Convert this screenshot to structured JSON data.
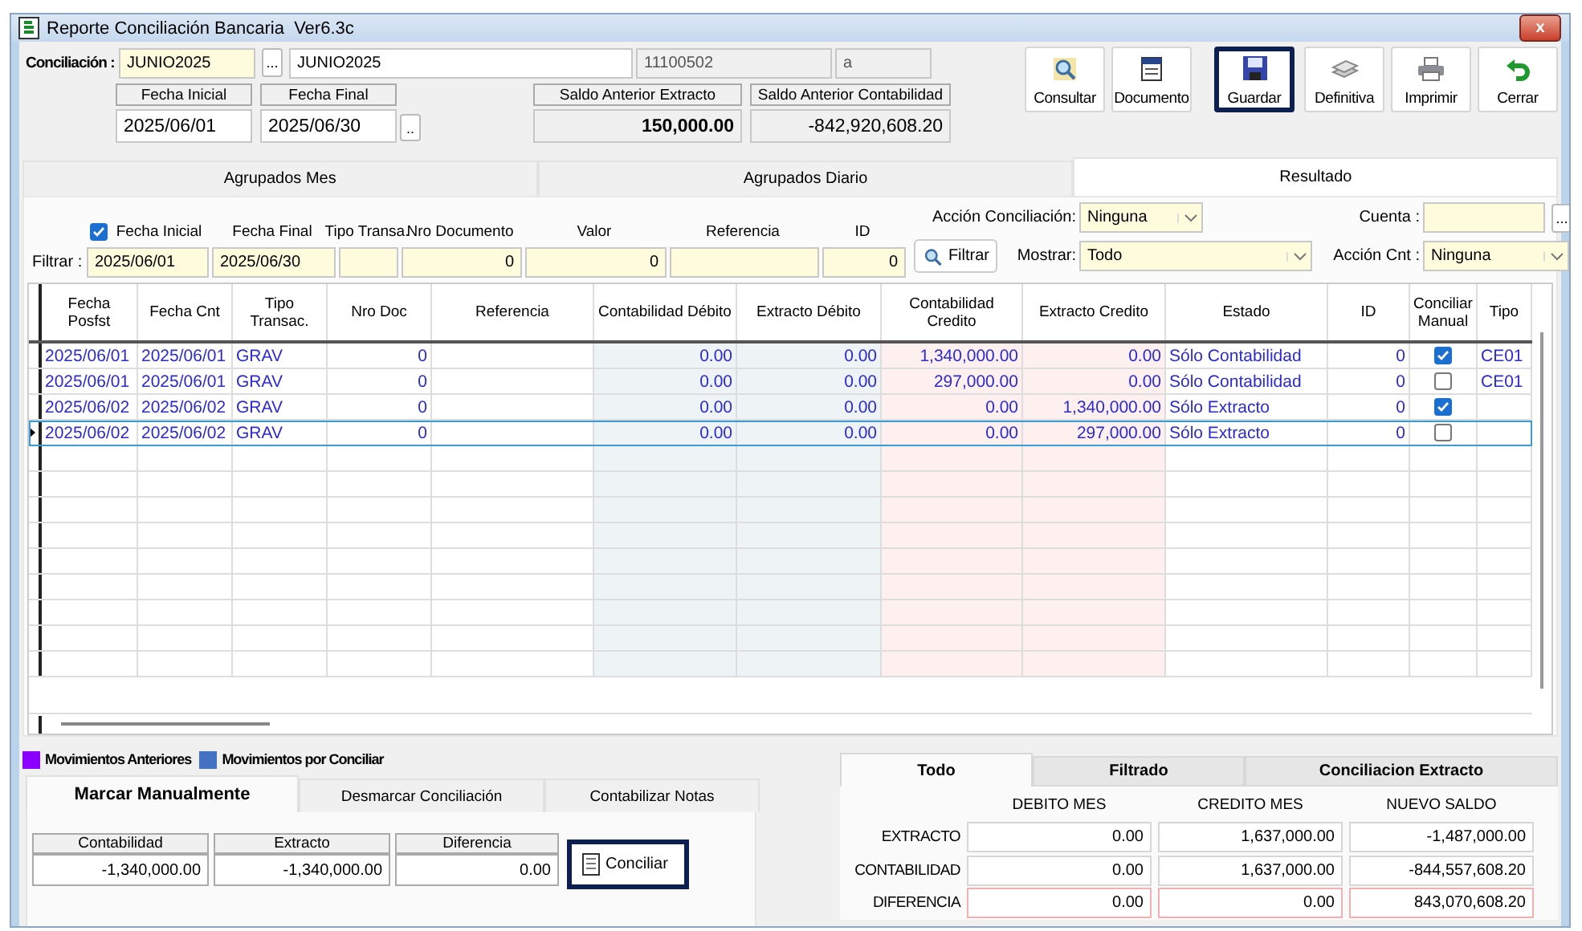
{
  "window": {
    "title": "Reporte Conciliación Bancaria  Ver6.3c",
    "close": "x"
  },
  "header": {
    "label": "Conciliación :",
    "code": "JUNIO2025",
    "picker": "...",
    "name": "JUNIO2025",
    "account": "11100502",
    "extra": "a",
    "fecha_inicial": {
      "label": "Fecha Inicial",
      "value": "2025/06/01"
    },
    "fecha_final": {
      "label": "Fecha Final",
      "value": "2025/06/30"
    },
    "date_picker": "..",
    "saldo_extracto": {
      "label": "Saldo Anterior  Extracto",
      "value": "150,000.00"
    },
    "saldo_contabilidad": {
      "label": "Saldo Anterior  Contabilidad",
      "value": "-842,920,608.20"
    }
  },
  "toolbar": [
    {
      "label": "Consultar",
      "kind": "search",
      "selected": false
    },
    {
      "label": "Documento",
      "kind": "document",
      "selected": false
    },
    {
      "label": "Guardar",
      "kind": "save",
      "selected": true
    },
    {
      "label": "Definitiva",
      "kind": "stack",
      "selected": false
    },
    {
      "label": "Imprimir",
      "kind": "printer",
      "selected": false
    },
    {
      "label": "Cerrar",
      "kind": "undo",
      "selected": false
    }
  ],
  "tabs": [
    {
      "label": "Agrupados Mes",
      "selected": false
    },
    {
      "label": "Agrupados Diario",
      "selected": false
    },
    {
      "label": "Resultado",
      "selected": true
    }
  ],
  "filter": {
    "label": "Filtrar :",
    "date_check": true,
    "fields": [
      {
        "label": "Fecha Inicial",
        "value": "2025/06/01",
        "kind": "date"
      },
      {
        "label": "Fecha Final",
        "value": "2025/06/30",
        "kind": "date"
      },
      {
        "label": "Tipo Transa.",
        "kind": "text"
      },
      {
        "label": "Nro Documento",
        "value": "0",
        "kind": "number"
      },
      {
        "label": "Valor",
        "value": "0",
        "kind": "number"
      },
      {
        "label": "Referencia",
        "kind": "text"
      },
      {
        "label": "ID",
        "value": "0",
        "kind": "number"
      }
    ],
    "button": "Filtrar",
    "accion_conciliacion": {
      "label": "Acción Conciliación:",
      "value": "Ninguna"
    },
    "mostrar": {
      "label": "Mostrar:",
      "value": "Todo"
    },
    "cuenta": {
      "label": "Cuenta :",
      "picker": "..."
    },
    "accion_cnt": {
      "label": "Acción Cnt :",
      "value": "Ninguna"
    }
  },
  "table": {
    "columns": [
      {
        "label": "Fecha Posfst",
        "kind": "text"
      },
      {
        "label": "Fecha Cnt",
        "kind": "text"
      },
      {
        "label": "Tipo Transac.",
        "kind": "text"
      },
      {
        "label": "Nro Doc",
        "kind": "num"
      },
      {
        "label": "Referencia",
        "kind": "blank"
      },
      {
        "label": "Contabilidad  Débito",
        "kind": "num"
      },
      {
        "label": "Extracto Débito",
        "kind": "num"
      },
      {
        "label": "Contabilidad  Credito",
        "kind": "num"
      },
      {
        "label": "Extracto Credito",
        "kind": "num"
      },
      {
        "label": "Estado",
        "kind": "text"
      },
      {
        "label": "ID",
        "kind": "num"
      },
      {
        "label": "Conciliar Manual",
        "kind": "check"
      },
      {
        "label": "Tipo",
        "kind": "code"
      }
    ],
    "rows": [
      {
        "current": false,
        "cells": [
          "2025/06/01",
          "2025/06/01",
          "GRAV",
          "0",
          "",
          "0.00",
          "0.00",
          "1,340,000.00",
          "0.00",
          "Sólo Contabilidad",
          "0"
        ],
        "manual": true,
        "tipo": "CE01"
      },
      {
        "current": false,
        "cells": [
          "2025/06/01",
          "2025/06/01",
          "GRAV",
          "0",
          "",
          "0.00",
          "0.00",
          "297,000.00",
          "0.00",
          "Sólo Contabilidad",
          "0"
        ],
        "manual": false,
        "tipo": "CE01"
      },
      {
        "current": false,
        "cells": [
          "2025/06/02",
          "2025/06/02",
          "GRAV",
          "0",
          "",
          "0.00",
          "0.00",
          "0.00",
          "1,340,000.00",
          "Sólo Extracto",
          "0"
        ],
        "manual": true
      },
      {
        "current": true,
        "cells": [
          "2025/06/02",
          "2025/06/02",
          "GRAV",
          "0",
          "",
          "0.00",
          "0.00",
          "0.00",
          "297,000.00",
          "Sólo Extracto",
          "0"
        ],
        "manual": false
      }
    ]
  },
  "legend": [
    {
      "label": "Movimientos Anteriores",
      "color": "#8b00ff"
    },
    {
      "label": "Movimientos por Conciliar",
      "color": "#4472c4"
    }
  ],
  "manual_panel": {
    "tabs": [
      {
        "label": "Marcar Manualmente",
        "selected": true
      },
      {
        "label": "Desmarcar Conciliación",
        "selected": false
      },
      {
        "label": "Contabilizar Notas",
        "selected": false
      }
    ],
    "totals": [
      {
        "label": "Contabilidad",
        "value": "-1,340,000.00"
      },
      {
        "label": "Extracto",
        "value": "-1,340,000.00"
      },
      {
        "label": "Diferencia",
        "value": "0.00"
      }
    ],
    "button": {
      "label": "Conciliar",
      "selected": true
    }
  },
  "summary": {
    "tabs": [
      {
        "label": "Todo",
        "selected": true
      },
      {
        "label": "Filtrado",
        "selected": false
      },
      {
        "label": "Conciliacion Extracto",
        "selected": false
      }
    ],
    "columns": [
      "DEBITO MES",
      "CREDITO MES",
      "NUEVO SALDO"
    ],
    "rows": [
      {
        "label": "EXTRACTO",
        "kind": "normal",
        "values": [
          "0.00",
          "1,637,000.00",
          "-1,487,000.00"
        ]
      },
      {
        "label": "CONTABILIDAD",
        "kind": "normal",
        "values": [
          "0.00",
          "1,637,000.00",
          "-844,557,608.20"
        ]
      },
      {
        "label": "DIFERENCIA",
        "kind": "difference",
        "values": [
          "0.00",
          "0.00",
          "843,070,608.20"
        ]
      }
    ]
  }
}
